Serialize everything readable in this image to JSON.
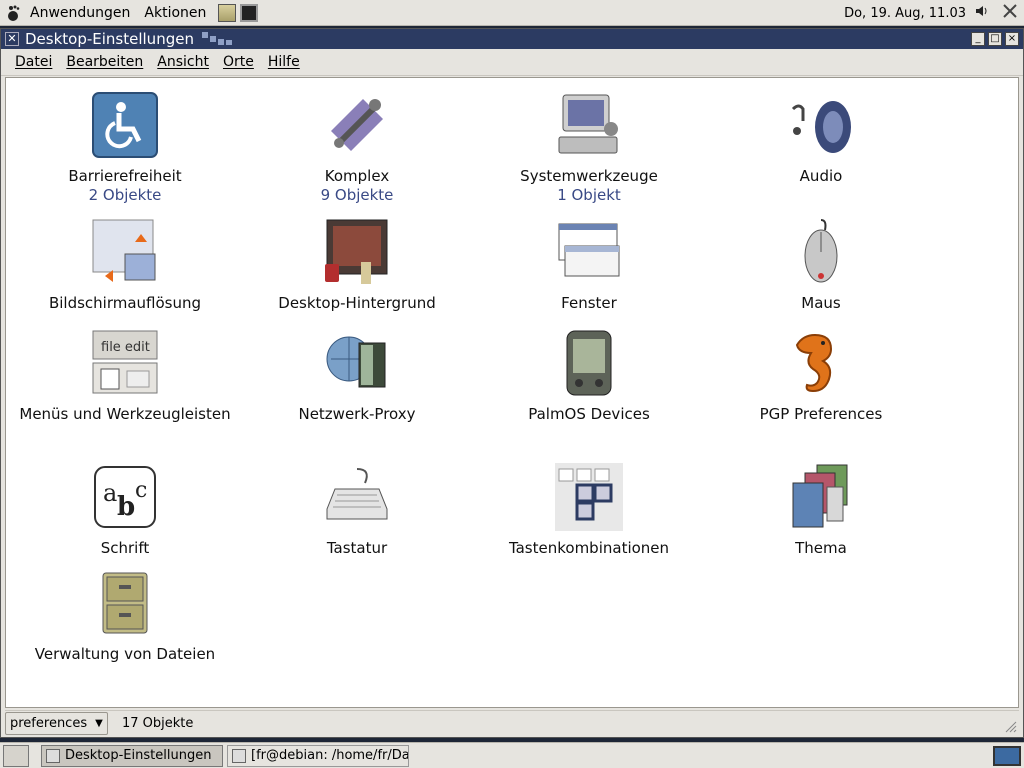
{
  "top_panel": {
    "applications": "Anwendungen",
    "actions": "Aktionen",
    "clock": "Do, 19. Aug, 11.03"
  },
  "window": {
    "title": "Desktop-Einstellungen",
    "menu": [
      "Datei",
      "Bearbeiten",
      "Ansicht",
      "Orte",
      "Hilfe"
    ],
    "items": [
      {
        "name": "Barrierefreiheit",
        "sub": "2 Objekte",
        "icon": "accessibility-icon"
      },
      {
        "name": "Komplex",
        "sub": "9 Objekte",
        "icon": "tools-icon"
      },
      {
        "name": "Systemwerkzeuge",
        "sub": "1 Objekt",
        "icon": "computer-icon"
      },
      {
        "name": "Audio",
        "sub": "",
        "icon": "speaker-icon"
      },
      {
        "name": "Bildschirmauflösung",
        "sub": "",
        "icon": "display-resolution-icon"
      },
      {
        "name": "Desktop-Hintergrund",
        "sub": "",
        "icon": "wallpaper-icon"
      },
      {
        "name": "Fenster",
        "sub": "",
        "icon": "windows-icon"
      },
      {
        "name": "Maus",
        "sub": "",
        "icon": "mouse-icon"
      },
      {
        "name": "Menüs und Werkzeugleisten",
        "sub": "",
        "icon": "menus-icon"
      },
      {
        "name": "Netzwerk-Proxy",
        "sub": "",
        "icon": "network-proxy-icon"
      },
      {
        "name": "PalmOS Devices",
        "sub": "",
        "icon": "palm-device-icon"
      },
      {
        "name": "PGP Preferences",
        "sub": "",
        "icon": "seahorse-icon"
      },
      {
        "name": "Schrift",
        "sub": "",
        "icon": "font-icon"
      },
      {
        "name": "Tastatur",
        "sub": "",
        "icon": "keyboard-icon"
      },
      {
        "name": "Tastenkombinationen",
        "sub": "",
        "icon": "shortcuts-icon"
      },
      {
        "name": "Thema",
        "sub": "",
        "icon": "theme-icon"
      },
      {
        "name": "Verwaltung von Dateien",
        "sub": "",
        "icon": "file-cabinet-icon"
      }
    ],
    "status": {
      "location": "preferences",
      "count": "17 Objekte"
    }
  },
  "taskbar": {
    "tasks": [
      "Desktop-Einstellungen",
      "[fr@debian: /home/fr/Dat"
    ]
  }
}
